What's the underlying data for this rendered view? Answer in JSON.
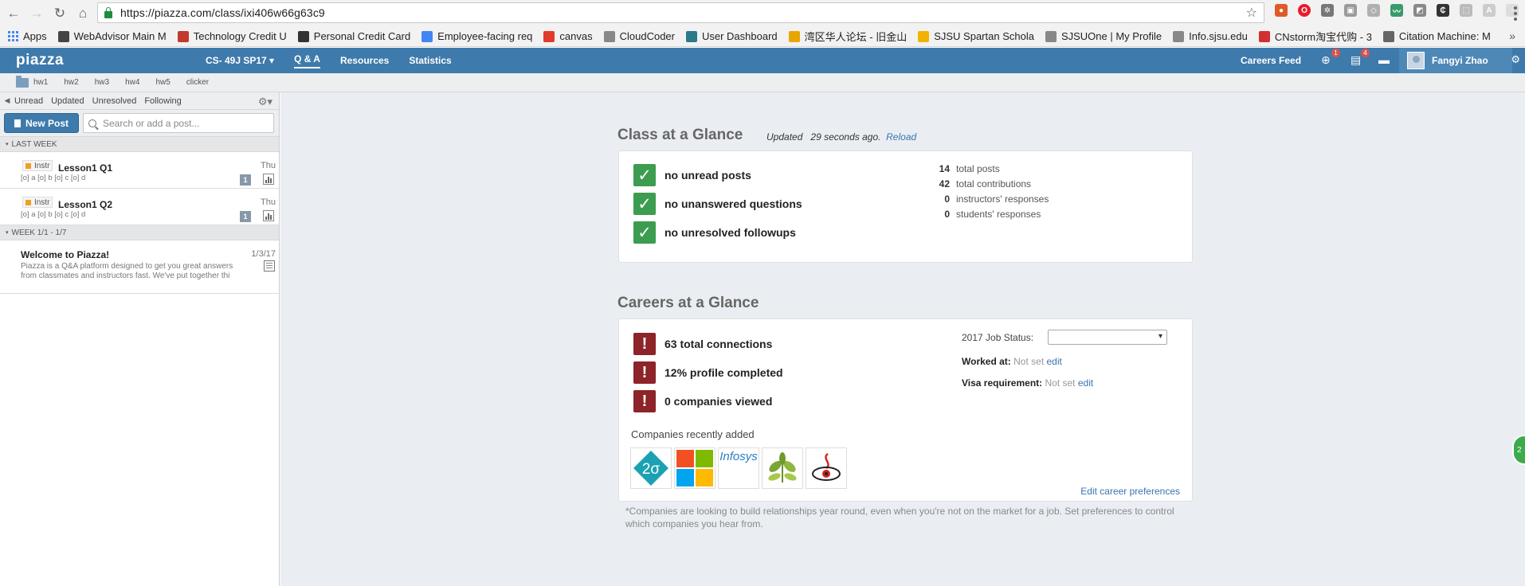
{
  "browser": {
    "url": "https://piazza.com/class/ixi406w66g63c9",
    "bookmarks": [
      {
        "label": "Apps",
        "icon": "apps-icon",
        "color": "#4285f4"
      },
      {
        "label": "WebAdvisor Main M",
        "icon": "webadvisor-icon",
        "color": "#444444"
      },
      {
        "label": "Technology Credit U",
        "icon": "tcu-icon",
        "color": "#c0392b"
      },
      {
        "label": "Personal Credit Card",
        "icon": "creditcard-icon",
        "color": "#333333"
      },
      {
        "label": "Employee-facing req",
        "icon": "google-icon",
        "color": "#4285f4"
      },
      {
        "label": "canvas",
        "icon": "canvas-icon",
        "color": "#e23b2a"
      },
      {
        "label": "CloudCoder",
        "icon": "page-icon",
        "color": "#888888"
      },
      {
        "label": "User Dashboard",
        "icon": "dashboard-icon",
        "color": "#2a7a8a"
      },
      {
        "label": "湾区华人论坛 - 旧金山",
        "icon": "chrome-icon",
        "color": "#e8a600"
      },
      {
        "label": "SJSU Spartan Schola",
        "icon": "sun-icon",
        "color": "#f0b400"
      },
      {
        "label": "SJSUOne | My Profile",
        "icon": "page-icon",
        "color": "#888888"
      },
      {
        "label": "Info.sjsu.edu",
        "icon": "page-icon",
        "color": "#888888"
      },
      {
        "label": "CNstorm淘宝代购 - 3",
        "icon": "cnstorm-icon",
        "color": "#d03030"
      },
      {
        "label": "Citation Machine: M",
        "icon": "citation-icon",
        "color": "#666666"
      }
    ]
  },
  "topbar": {
    "logo": "piazza",
    "class_name": "CS- 49J SP17 ▾",
    "nav": [
      "Q & A",
      "Resources",
      "Statistics"
    ],
    "careers_feed": "Careers Feed",
    "badge_globe": "1",
    "badge_feed": "4",
    "user_name": "Fangyi Zhao"
  },
  "folders": [
    "hw1",
    "hw2",
    "hw3",
    "hw4",
    "hw5",
    "clicker"
  ],
  "sidebar": {
    "filters": [
      "Unread",
      "Updated",
      "Unresolved",
      "Following"
    ],
    "new_post": "New Post",
    "search_placeholder": "Search or add a post...",
    "groups": [
      {
        "title": "LAST WEEK",
        "posts": [
          {
            "tag": "Instr",
            "title": "Lesson1 Q1",
            "sub": "[o] a [o] b [o] c [o] d",
            "date": "Thu",
            "count": "1"
          },
          {
            "tag": "Instr",
            "title": "Lesson1 Q2",
            "sub": "[o] a [o] b [o] c [o] d",
            "date": "Thu",
            "count": "1"
          }
        ]
      },
      {
        "title": "WEEK 1/1 - 1/7",
        "posts": [
          {
            "title": "Welcome to Piazza!",
            "sub": "Piazza is a Q&A platform designed to get you great answers from classmates and instructors fast. We've put together thi",
            "date": "1/3/17"
          }
        ]
      }
    ]
  },
  "class_glance": {
    "title": "Class at a Glance",
    "updated_prefix": "Updated",
    "updated_time": "29 seconds ago.",
    "reload": "Reload",
    "checks": [
      "no unread posts",
      "no unanswered questions",
      "no unresolved followups"
    ],
    "stats": [
      {
        "num": "14",
        "label": "total posts"
      },
      {
        "num": "42",
        "label": "total contributions"
      },
      {
        "num": "0",
        "label": "instructors' responses"
      },
      {
        "num": "0",
        "label": "students' responses"
      }
    ]
  },
  "careers_glance": {
    "title": "Careers at a Glance",
    "alerts": [
      "63 total connections",
      "12% profile completed",
      "0 companies viewed"
    ],
    "companies_label": "Companies recently added",
    "company_logos": [
      "2σ",
      "microsoft-logo",
      "Infosys",
      "plant-logo",
      "eye-logo"
    ],
    "job_status_label": "2017 Job Status:",
    "worked_at_label": "Worked at:",
    "visa_label": "Visa requirement:",
    "not_set": "Not set",
    "edit": "edit",
    "edit_prefs": "Edit career preferences",
    "footnote": "*Companies are looking to build relationships year round, even when you're not on the market for a job. Set preferences to control which companies you hear from."
  },
  "side_bubble": "2"
}
